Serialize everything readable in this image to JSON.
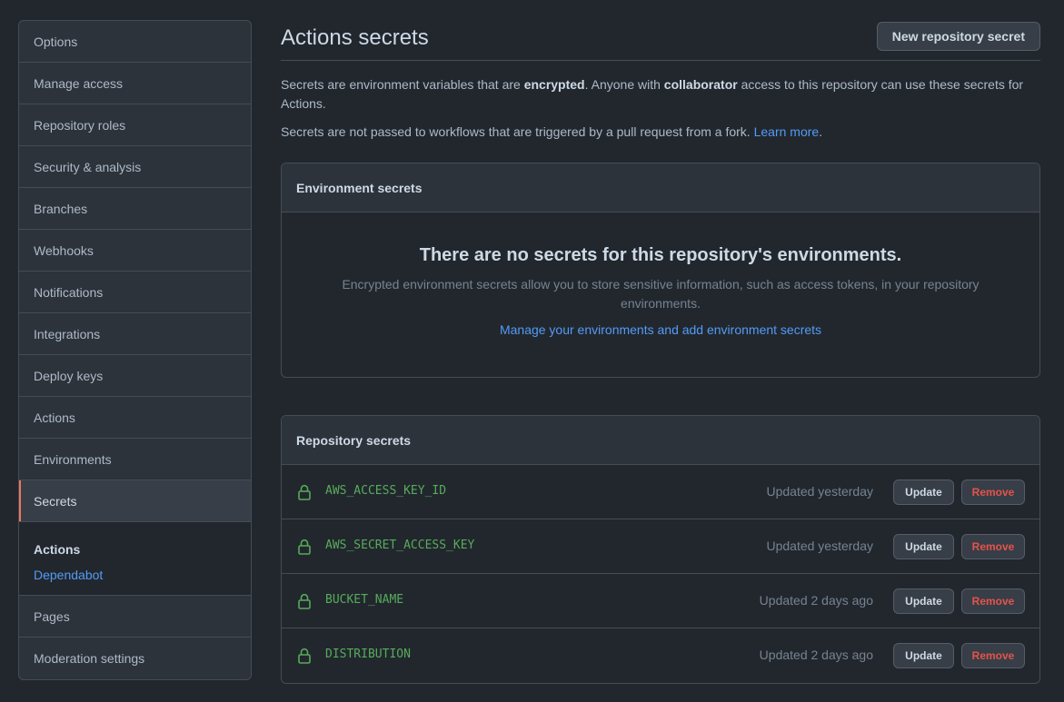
{
  "sidebar": {
    "items_top": [
      "Options",
      "Manage access",
      "Repository roles",
      "Security & analysis",
      "Branches",
      "Webhooks",
      "Notifications",
      "Integrations",
      "Deploy keys",
      "Actions",
      "Environments",
      "Secrets"
    ],
    "subnav_heading": "Actions",
    "subnav_link": "Dependabot",
    "items_bottom": [
      "Pages",
      "Moderation settings"
    ]
  },
  "header": {
    "title": "Actions secrets",
    "new_button": "New repository secret"
  },
  "description": {
    "p1_a": "Secrets are environment variables that are ",
    "p1_b": "encrypted",
    "p1_c": ". Anyone with ",
    "p1_d": "collaborator",
    "p1_e": " access to this repository can use these secrets for Actions.",
    "p2_a": "Secrets are not passed to workflows that are triggered by a pull request from a fork. ",
    "p2_link": "Learn more",
    "p2_end": "."
  },
  "environment_secrets": {
    "header": "Environment secrets",
    "empty_title": "There are no secrets for this repository's environments.",
    "empty_text": "Encrypted environment secrets allow you to store sensitive information, such as access tokens, in your repository environments.",
    "manage_link": "Manage your environments and add environment secrets"
  },
  "repository_secrets": {
    "header": "Repository secrets",
    "update_label": "Update",
    "remove_label": "Remove",
    "rows": [
      {
        "name": "AWS_ACCESS_KEY_ID",
        "updated": "Updated yesterday"
      },
      {
        "name": "AWS_SECRET_ACCESS_KEY",
        "updated": "Updated yesterday"
      },
      {
        "name": "BUCKET_NAME",
        "updated": "Updated 2 days ago"
      },
      {
        "name": "DISTRIBUTION",
        "updated": "Updated 2 days ago"
      }
    ]
  },
  "colors": {
    "background": "#22272e",
    "accent_link": "#539bf5",
    "secret_name": "#57ab5a",
    "remove": "#e5534b",
    "selected_marker": "#ec775c"
  }
}
